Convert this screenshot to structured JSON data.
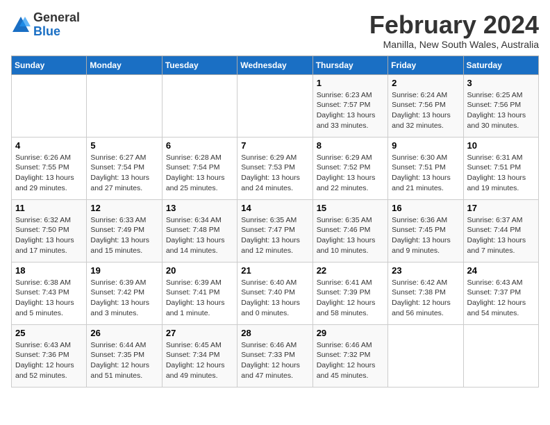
{
  "header": {
    "logo": {
      "general": "General",
      "blue": "Blue"
    },
    "title": "February 2024",
    "location": "Manilla, New South Wales, Australia"
  },
  "calendar": {
    "days_of_week": [
      "Sunday",
      "Monday",
      "Tuesday",
      "Wednesday",
      "Thursday",
      "Friday",
      "Saturday"
    ],
    "weeks": [
      [
        {
          "day": "",
          "info": ""
        },
        {
          "day": "",
          "info": ""
        },
        {
          "day": "",
          "info": ""
        },
        {
          "day": "",
          "info": ""
        },
        {
          "day": "1",
          "info": "Sunrise: 6:23 AM\nSunset: 7:57 PM\nDaylight: 13 hours\nand 33 minutes."
        },
        {
          "day": "2",
          "info": "Sunrise: 6:24 AM\nSunset: 7:56 PM\nDaylight: 13 hours\nand 32 minutes."
        },
        {
          "day": "3",
          "info": "Sunrise: 6:25 AM\nSunset: 7:56 PM\nDaylight: 13 hours\nand 30 minutes."
        }
      ],
      [
        {
          "day": "4",
          "info": "Sunrise: 6:26 AM\nSunset: 7:55 PM\nDaylight: 13 hours\nand 29 minutes."
        },
        {
          "day": "5",
          "info": "Sunrise: 6:27 AM\nSunset: 7:54 PM\nDaylight: 13 hours\nand 27 minutes."
        },
        {
          "day": "6",
          "info": "Sunrise: 6:28 AM\nSunset: 7:54 PM\nDaylight: 13 hours\nand 25 minutes."
        },
        {
          "day": "7",
          "info": "Sunrise: 6:29 AM\nSunset: 7:53 PM\nDaylight: 13 hours\nand 24 minutes."
        },
        {
          "day": "8",
          "info": "Sunrise: 6:29 AM\nSunset: 7:52 PM\nDaylight: 13 hours\nand 22 minutes."
        },
        {
          "day": "9",
          "info": "Sunrise: 6:30 AM\nSunset: 7:51 PM\nDaylight: 13 hours\nand 21 minutes."
        },
        {
          "day": "10",
          "info": "Sunrise: 6:31 AM\nSunset: 7:51 PM\nDaylight: 13 hours\nand 19 minutes."
        }
      ],
      [
        {
          "day": "11",
          "info": "Sunrise: 6:32 AM\nSunset: 7:50 PM\nDaylight: 13 hours\nand 17 minutes."
        },
        {
          "day": "12",
          "info": "Sunrise: 6:33 AM\nSunset: 7:49 PM\nDaylight: 13 hours\nand 15 minutes."
        },
        {
          "day": "13",
          "info": "Sunrise: 6:34 AM\nSunset: 7:48 PM\nDaylight: 13 hours\nand 14 minutes."
        },
        {
          "day": "14",
          "info": "Sunrise: 6:35 AM\nSunset: 7:47 PM\nDaylight: 13 hours\nand 12 minutes."
        },
        {
          "day": "15",
          "info": "Sunrise: 6:35 AM\nSunset: 7:46 PM\nDaylight: 13 hours\nand 10 minutes."
        },
        {
          "day": "16",
          "info": "Sunrise: 6:36 AM\nSunset: 7:45 PM\nDaylight: 13 hours\nand 9 minutes."
        },
        {
          "day": "17",
          "info": "Sunrise: 6:37 AM\nSunset: 7:44 PM\nDaylight: 13 hours\nand 7 minutes."
        }
      ],
      [
        {
          "day": "18",
          "info": "Sunrise: 6:38 AM\nSunset: 7:43 PM\nDaylight: 13 hours\nand 5 minutes."
        },
        {
          "day": "19",
          "info": "Sunrise: 6:39 AM\nSunset: 7:42 PM\nDaylight: 13 hours\nand 3 minutes."
        },
        {
          "day": "20",
          "info": "Sunrise: 6:39 AM\nSunset: 7:41 PM\nDaylight: 13 hours\nand 1 minute."
        },
        {
          "day": "21",
          "info": "Sunrise: 6:40 AM\nSunset: 7:40 PM\nDaylight: 13 hours\nand 0 minutes."
        },
        {
          "day": "22",
          "info": "Sunrise: 6:41 AM\nSunset: 7:39 PM\nDaylight: 12 hours\nand 58 minutes."
        },
        {
          "day": "23",
          "info": "Sunrise: 6:42 AM\nSunset: 7:38 PM\nDaylight: 12 hours\nand 56 minutes."
        },
        {
          "day": "24",
          "info": "Sunrise: 6:43 AM\nSunset: 7:37 PM\nDaylight: 12 hours\nand 54 minutes."
        }
      ],
      [
        {
          "day": "25",
          "info": "Sunrise: 6:43 AM\nSunset: 7:36 PM\nDaylight: 12 hours\nand 52 minutes."
        },
        {
          "day": "26",
          "info": "Sunrise: 6:44 AM\nSunset: 7:35 PM\nDaylight: 12 hours\nand 51 minutes."
        },
        {
          "day": "27",
          "info": "Sunrise: 6:45 AM\nSunset: 7:34 PM\nDaylight: 12 hours\nand 49 minutes."
        },
        {
          "day": "28",
          "info": "Sunrise: 6:46 AM\nSunset: 7:33 PM\nDaylight: 12 hours\nand 47 minutes."
        },
        {
          "day": "29",
          "info": "Sunrise: 6:46 AM\nSunset: 7:32 PM\nDaylight: 12 hours\nand 45 minutes."
        },
        {
          "day": "",
          "info": ""
        },
        {
          "day": "",
          "info": ""
        }
      ]
    ]
  }
}
